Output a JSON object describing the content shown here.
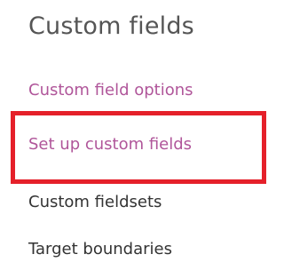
{
  "section": {
    "title": "Custom fields"
  },
  "nav": {
    "items": [
      {
        "label": "Custom field options"
      },
      {
        "label": "Set up custom fields"
      },
      {
        "label": "Custom fieldsets"
      },
      {
        "label": "Target boundaries"
      }
    ]
  },
  "colors": {
    "title": "#555555",
    "link": "#b0569a",
    "text": "#333333",
    "highlight": "#e5202a"
  }
}
